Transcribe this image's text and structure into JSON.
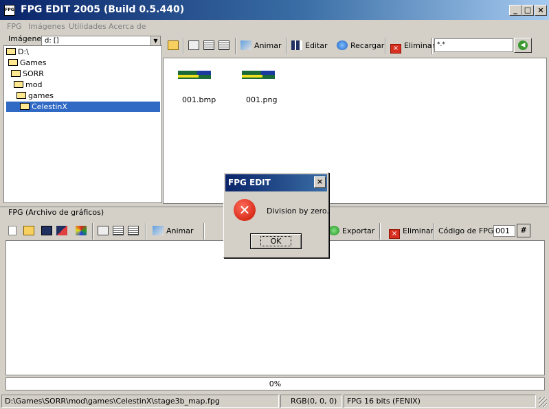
{
  "window": {
    "title": "FPG EDIT 2005 (Build 0.5.440)",
    "icon_text": "FPG",
    "controls": {
      "minimize": "_",
      "maximize": "□",
      "close": "×"
    }
  },
  "menu": [
    "FPG",
    "Imágenes",
    "Utilidades",
    "Acerca de"
  ],
  "images_panel": {
    "group_label": "Imágenes",
    "drive_select": "d: []",
    "tree": [
      {
        "label": "D:\\",
        "indent": 0
      },
      {
        "label": "Games",
        "indent": 1
      },
      {
        "label": "SORR",
        "indent": 1
      },
      {
        "label": "mod",
        "indent": 2
      },
      {
        "label": "games",
        "indent": 2
      },
      {
        "label": "CelestinX",
        "indent": 3,
        "selected": true
      }
    ]
  },
  "images_toolbar": {
    "animate": "Animar",
    "edit": "Editar",
    "reload": "Recargar",
    "delete": "Eliminar",
    "filter_value": "*.*"
  },
  "files": [
    {
      "name": "001.bmp"
    },
    {
      "name": "001.png"
    }
  ],
  "fpg_panel": {
    "group_label": "FPG (Archivo de gráficos)",
    "toolbar": {
      "animate": "Animar",
      "export": "Exportar",
      "delete": "Eliminar",
      "code_label": "Código de FPG:",
      "code_value": "001"
    },
    "progress": "0%"
  },
  "status": {
    "path": "D:\\Games\\SORR\\mod\\games\\CelestinX\\stage3b_map.fpg",
    "rgb": "RGB(0, 0, 0)",
    "format": "FPG 16 bits (FENIX)"
  },
  "dialog": {
    "title": "FPG EDIT",
    "close": "×",
    "message": "Division by zero.",
    "ok": "OK",
    "icon": "error-icon"
  }
}
